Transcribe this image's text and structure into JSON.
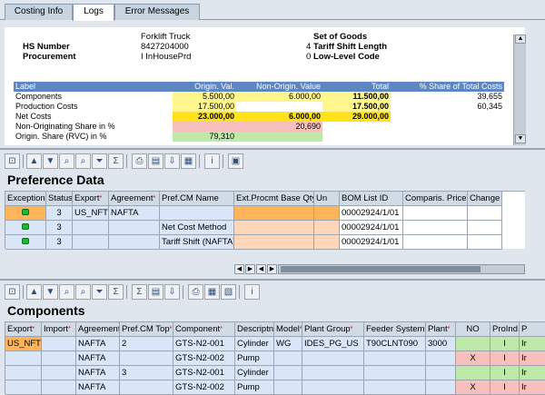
{
  "tabs": [
    {
      "label": "Costing Info"
    },
    {
      "label": "Logs"
    },
    {
      "label": "Error Messages"
    }
  ],
  "header": {
    "product_name": "Forklift Truck",
    "hs_number_label": "HS Number",
    "hs_number_value": "8427204000",
    "procurement_label": "Procurement",
    "procurement_value": "I InHousePrd",
    "set_of_goods_label": "Set of Goods",
    "tariff_shift_length_label": "Tariff Shift Length",
    "tariff_shift_length_value": "4",
    "low_level_code_label": "Low-Level Code",
    "low_level_code_value": "0"
  },
  "costs_table": {
    "columns": [
      "Label",
      "Origin. Val.",
      "Non-Origin. Value",
      "Total",
      "% Share of Total Costs"
    ],
    "rows": [
      {
        "label": "Components",
        "origin": "5.500,00",
        "non_origin": "6.000,00",
        "total": "11.500,00",
        "share": "39,655"
      },
      {
        "label": "Production Costs",
        "origin": "17.500,00",
        "non_origin": "",
        "total": "17.500,00",
        "share": "60,345"
      },
      {
        "label": "Net Costs",
        "origin": "23.000,00",
        "non_origin": "6.000,00",
        "total": "29.000,00",
        "share": ""
      },
      {
        "label": "Non-Originating Share in %",
        "origin": "",
        "non_origin": "20,690",
        "total": "",
        "share": ""
      },
      {
        "label": "Origin. Share (RVC) in %",
        "origin": "79,310",
        "non_origin": "",
        "total": "",
        "share": ""
      }
    ]
  },
  "preference": {
    "title": "Preference Data",
    "columns": [
      "Exception",
      "Status",
      "Export",
      "Agreement",
      "Pref.CM Name",
      "Ext.Procmt Base Qty",
      "Un",
      "BOM List ID",
      "Comparis. Price",
      "Change"
    ],
    "rows": [
      {
        "status": "3",
        "export": "US_NFT",
        "agreement": "NAFTA",
        "pref_cm": "",
        "bom": "00002924/1/01"
      },
      {
        "status": "3",
        "export": "",
        "agreement": "",
        "pref_cm": "Net Cost Method",
        "bom": "00002924/1/01"
      },
      {
        "status": "3",
        "export": "",
        "agreement": "",
        "pref_cm": "Tariff Shift (NAFTA)",
        "bom": "00002924/1/01"
      }
    ]
  },
  "components": {
    "title": "Components",
    "columns": [
      "Export",
      "Import",
      "Agreement",
      "Pref.CM Top",
      "Component",
      "Descriptn",
      "Model",
      "Plant Group",
      "Feeder System",
      "Plant",
      "NO",
      "ProInd",
      "P"
    ],
    "rows": [
      {
        "export": "US_NFT",
        "import": "",
        "agreement": "NAFTA",
        "pref_cm_top": "2",
        "component": "GTS-N2-001",
        "descr": "Cylinder",
        "model": "WG",
        "plant_group": "IDES_PG_US",
        "feeder": "T90CLNT090",
        "plant": "3000",
        "no": "",
        "proind": "I",
        "p": "Ir"
      },
      {
        "export": "",
        "import": "",
        "agreement": "NAFTA",
        "pref_cm_top": "",
        "component": "GTS-N2-002",
        "descr": "Pump",
        "model": "",
        "plant_group": "",
        "feeder": "",
        "plant": "",
        "no": "X",
        "proind": "I",
        "p": "Ir"
      },
      {
        "export": "",
        "import": "",
        "agreement": "NAFTA",
        "pref_cm_top": "3",
        "component": "GTS-N2-001",
        "descr": "Cylinder",
        "model": "",
        "plant_group": "",
        "feeder": "",
        "plant": "",
        "no": "",
        "proind": "I",
        "p": "Ir"
      },
      {
        "export": "",
        "import": "",
        "agreement": "NAFTA",
        "pref_cm_top": "",
        "component": "GTS-N2-002",
        "descr": "Pump",
        "model": "",
        "plant_group": "",
        "feeder": "",
        "plant": "",
        "no": "X",
        "proind": "I",
        "p": "Ir"
      }
    ]
  },
  "colors": {
    "header_blue": "#5d86c2",
    "yellow": "#fff68e",
    "bright_yellow": "#ffe21a",
    "pink": "#f7c0bd",
    "green": "#bfe9a8",
    "orange": "#ffb45a",
    "peach": "#ffd7b8",
    "led_green": "#1dbb34"
  }
}
